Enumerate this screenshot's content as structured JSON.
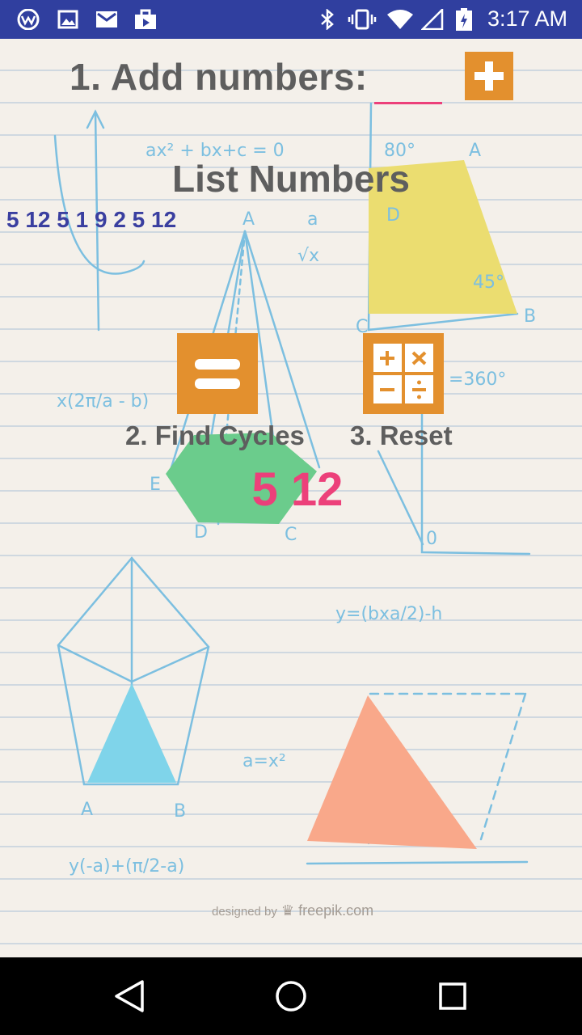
{
  "status_bar": {
    "time": "3:17 AM",
    "left_icons": [
      "app-logo-icon",
      "image-icon",
      "mail-icon",
      "briefcase-icon"
    ],
    "right_icons": [
      "bluetooth-icon",
      "vibrate-icon",
      "wifi-icon",
      "signal-icon",
      "battery-icon"
    ]
  },
  "main": {
    "add_label": "1. Add numbers:",
    "input_value": "",
    "list_title": "List Numbers",
    "list_values": "5 12 5 1 9 2 5 12",
    "find_label": "2. Find Cycles",
    "reset_label": "3. Reset",
    "result": "5 12"
  },
  "background": {
    "credit_prefix": "designed by",
    "credit_site": "freepik.com"
  },
  "nav_bar": {
    "buttons": [
      "back-icon",
      "home-icon",
      "recents-icon"
    ]
  },
  "colors": {
    "status_bar": "#303f9f",
    "button": "#e3902e",
    "accent": "#ec407a",
    "list_text": "#3a3fa0",
    "label_text": "#5e5e5e"
  }
}
